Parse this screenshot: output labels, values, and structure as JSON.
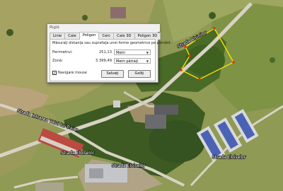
{
  "dialog": {
    "title": "Riglă",
    "tabs": [
      {
        "label": "Linie",
        "active": false
      },
      {
        "label": "Cale",
        "active": false
      },
      {
        "label": "Poligon",
        "active": true
      },
      {
        "label": "Cerc",
        "active": false
      },
      {
        "label": "Cale 3D",
        "active": false
      },
      {
        "label": "Poligon 3D",
        "active": false
      }
    ],
    "description": "Măsuraţi distanţa sau suprafaţa unei forme geometrice pe pământ",
    "perimeter": {
      "label": "Perimetrul:",
      "value": "251,13",
      "unit": "Metri"
    },
    "area": {
      "label": "Zonă:",
      "value": "3.399,49",
      "unit": "Metri pătraţi"
    },
    "mouse_navigation": {
      "label": "Navigare mouse",
      "checked": true
    },
    "save_button": "Salvaţi",
    "clear_button": "Goliţi"
  },
  "map": {
    "labels": [
      "Strada Vişinilor",
      "Strada Intrarea Valul lui Traian",
      "Strada Eloiselor",
      "Strada Eloiselor",
      "Strada Eloiselor"
    ],
    "polygon_color": "#f2e300",
    "vertex_color": "#e0301e"
  }
}
